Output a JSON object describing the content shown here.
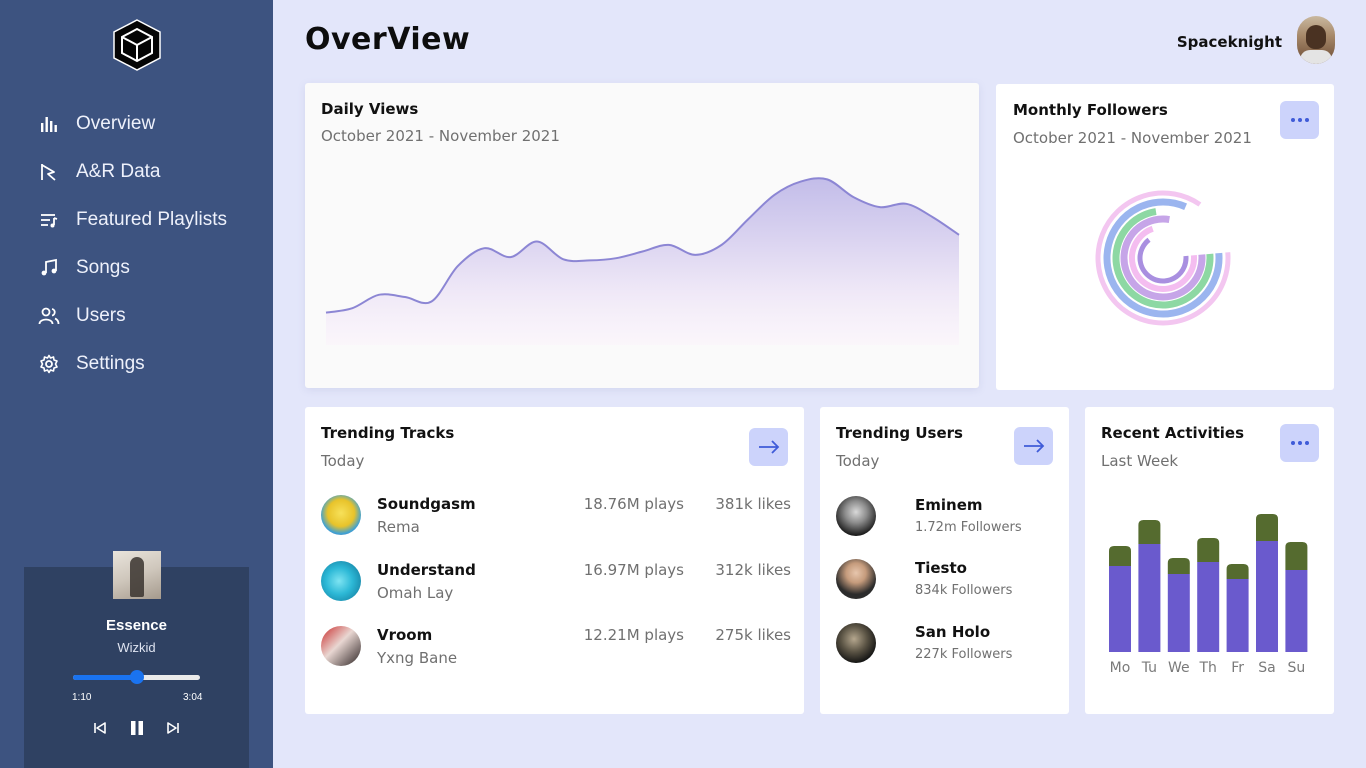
{
  "app": {
    "logo_icon": "cube-icon"
  },
  "sidebar": {
    "items": [
      {
        "label": "Overview",
        "icon": "bar-chart-icon"
      },
      {
        "label": "A&R Data",
        "icon": "pen-tool-icon"
      },
      {
        "label": "Featured Playlists",
        "icon": "playlist-icon"
      },
      {
        "label": "Songs",
        "icon": "music-note-icon"
      },
      {
        "label": "Users",
        "icon": "users-icon"
      },
      {
        "label": "Settings",
        "icon": "gear-icon"
      }
    ]
  },
  "player": {
    "title": "Essence",
    "artist": "Wizkid",
    "elapsed": "1:10",
    "duration": "3:04",
    "progress": 0.5
  },
  "header": {
    "title": "OverView",
    "username": "Spaceknight"
  },
  "daily_views": {
    "title": "Daily Views",
    "range": "October 2021 - November 2021",
    "chart_data": {
      "type": "area",
      "values": [
        22,
        26,
        38,
        36,
        32,
        64,
        80,
        72,
        86,
        70,
        69,
        71,
        77,
        83,
        74,
        83,
        106,
        128,
        140,
        142,
        126,
        117,
        120,
        108,
        92
      ],
      "line_color": "#8c86d4"
    }
  },
  "monthly_followers": {
    "title": "Monthly Followers",
    "range": "October 2021 - November 2021",
    "menu_icon": "more-horizontal-icon",
    "chart_data": {
      "type": "radial-bar",
      "values": [
        0.86,
        0.83,
        0.74,
        0.79,
        0.71,
        0.66
      ],
      "colors": [
        "#f3c6f0",
        "#9bb5ef",
        "#8dd8a3",
        "#c6a5e8",
        "#f4bdf0",
        "#a98fe0"
      ]
    }
  },
  "trending_tracks": {
    "title": "Trending Tracks",
    "period": "Today",
    "action_icon": "arrow-right-icon",
    "items": [
      {
        "name": "Soundgasm",
        "artist": "Rema",
        "plays": "18.76M plays",
        "likes": "381k likes"
      },
      {
        "name": "Understand",
        "artist": "Omah Lay",
        "plays": "16.97M plays",
        "likes": "312k likes"
      },
      {
        "name": "Vroom",
        "artist": "Yxng Bane",
        "plays": "12.21M plays",
        "likes": "275k likes"
      }
    ]
  },
  "trending_users": {
    "title": "Trending Users",
    "period": "Today",
    "action_icon": "arrow-right-icon",
    "items": [
      {
        "name": "Eminem",
        "followers": "1.72m Followers"
      },
      {
        "name": "Tiesto",
        "followers": "834k Followers"
      },
      {
        "name": "San Holo",
        "followers": "227k Followers"
      }
    ]
  },
  "recent_activities": {
    "title": "Recent Activities",
    "period": "Last Week",
    "menu_icon": "more-horizontal-icon",
    "chart_data": {
      "type": "bar",
      "categories": [
        "Mo",
        "Tu",
        "We",
        "Th",
        "Fr",
        "Sa",
        "Su"
      ],
      "series": [
        {
          "values": [
            86,
            108,
            78,
            90,
            73,
            111,
            82
          ],
          "color": "#6a5acd"
        },
        {
          "values": [
            20,
            24,
            16,
            24,
            15,
            27,
            28
          ],
          "color": "#556b2f"
        }
      ],
      "ylim": [
        0,
        140
      ]
    }
  }
}
